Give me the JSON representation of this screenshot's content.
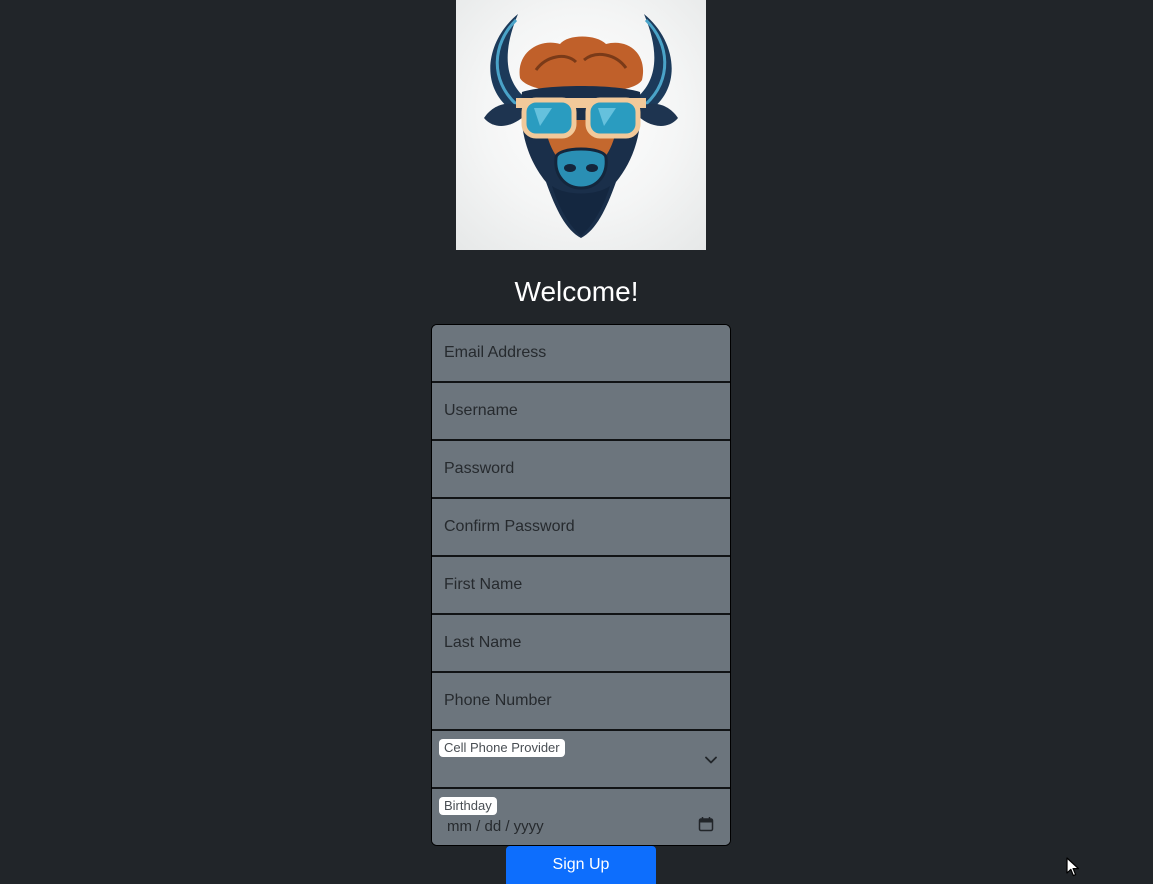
{
  "header": {
    "welcome": "Welcome!"
  },
  "form": {
    "email_placeholder": "Email Address",
    "username_placeholder": "Username",
    "password_placeholder": "Password",
    "confirm_password_placeholder": "Confirm Password",
    "first_name_placeholder": "First Name",
    "last_name_placeholder": "Last Name",
    "phone_placeholder": "Phone Number",
    "provider_label": "Cell Phone Provider",
    "birthday_label": "Birthday",
    "birthday_value": "mm / dd / yyyy",
    "submit_label": "Sign Up"
  },
  "icons": {
    "logo": "bison-with-sunglasses-logo",
    "provider_dropdown": "chevron-down-icon",
    "birthday_picker": "calendar-icon",
    "cursor": "mouse-pointer-icon"
  },
  "colors": {
    "background": "#212529",
    "field": "#6c757d",
    "button": "#0d6efd"
  }
}
